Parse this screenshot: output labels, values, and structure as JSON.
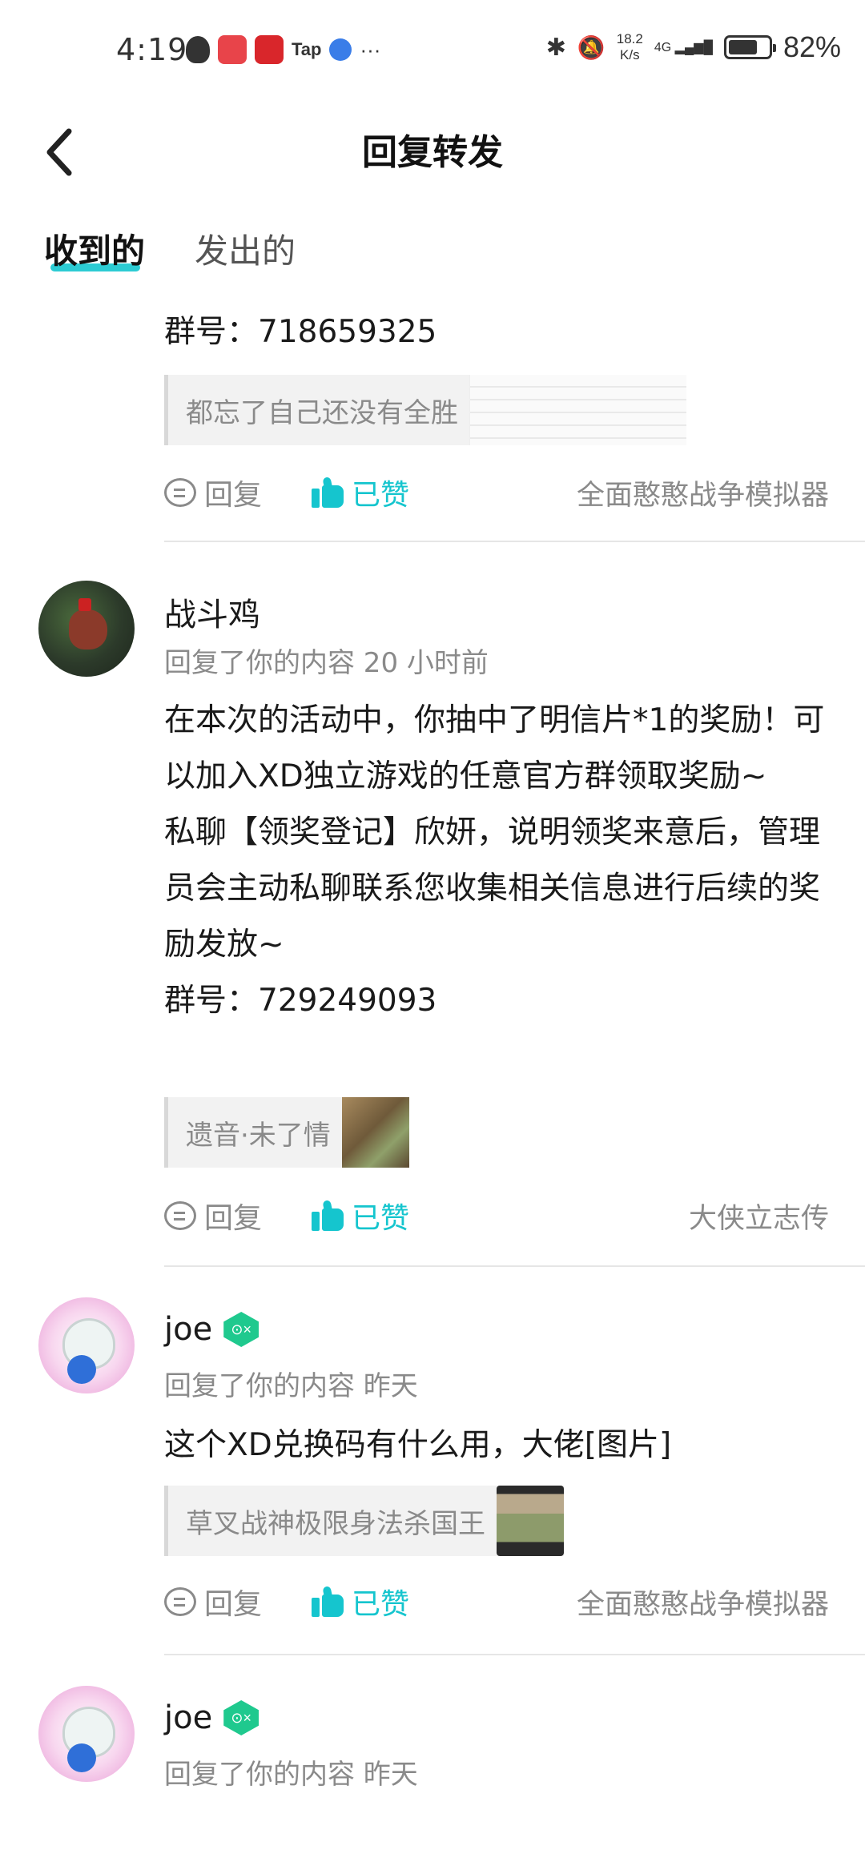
{
  "status_bar": {
    "time": "4:19",
    "network_speed_top": "18.2",
    "network_speed_bottom": "K/s",
    "signal": "4G",
    "battery_pct": "82%",
    "battery_level": 0.82
  },
  "header": {
    "title": "回复转发"
  },
  "tabs": [
    {
      "label": "收到的",
      "active": true
    },
    {
      "label": "发出的",
      "active": false
    }
  ],
  "items": [
    {
      "body": "群号：718659325",
      "quote": "都忘了自己还没有全胜",
      "reply_label": "回复",
      "liked_label": "已赞",
      "game": "全面憨憨战争模拟器"
    },
    {
      "name": "战斗鸡",
      "meta": "回复了你的内容 20 小时前",
      "body": "在本次的活动中，你抽中了明信片*1的奖励！可以加入XD独立游戏的任意官方群领取奖励~\n私聊【领奖登记】欣妍，说明领奖来意后，管理员会主动私聊联系您收集相关信息进行后续的奖励发放~\n群号：729249093",
      "quote": "遗音·未了情",
      "reply_label": "回复",
      "liked_label": "已赞",
      "game": "大侠立志传"
    },
    {
      "name": "joe",
      "meta": "回复了你的内容 昨天",
      "body": "这个XD兑换码有什么用，大佬[图片]",
      "quote": "草叉战神极限身法杀国王",
      "reply_label": "回复",
      "liked_label": "已赞",
      "game": "全面憨憨战争模拟器"
    },
    {
      "name": "joe",
      "meta": "回复了你的内容 昨天"
    }
  ],
  "colors": {
    "accent": "#15c5ce",
    "badge": "#1fc98e",
    "muted": "#8a8a8a"
  }
}
